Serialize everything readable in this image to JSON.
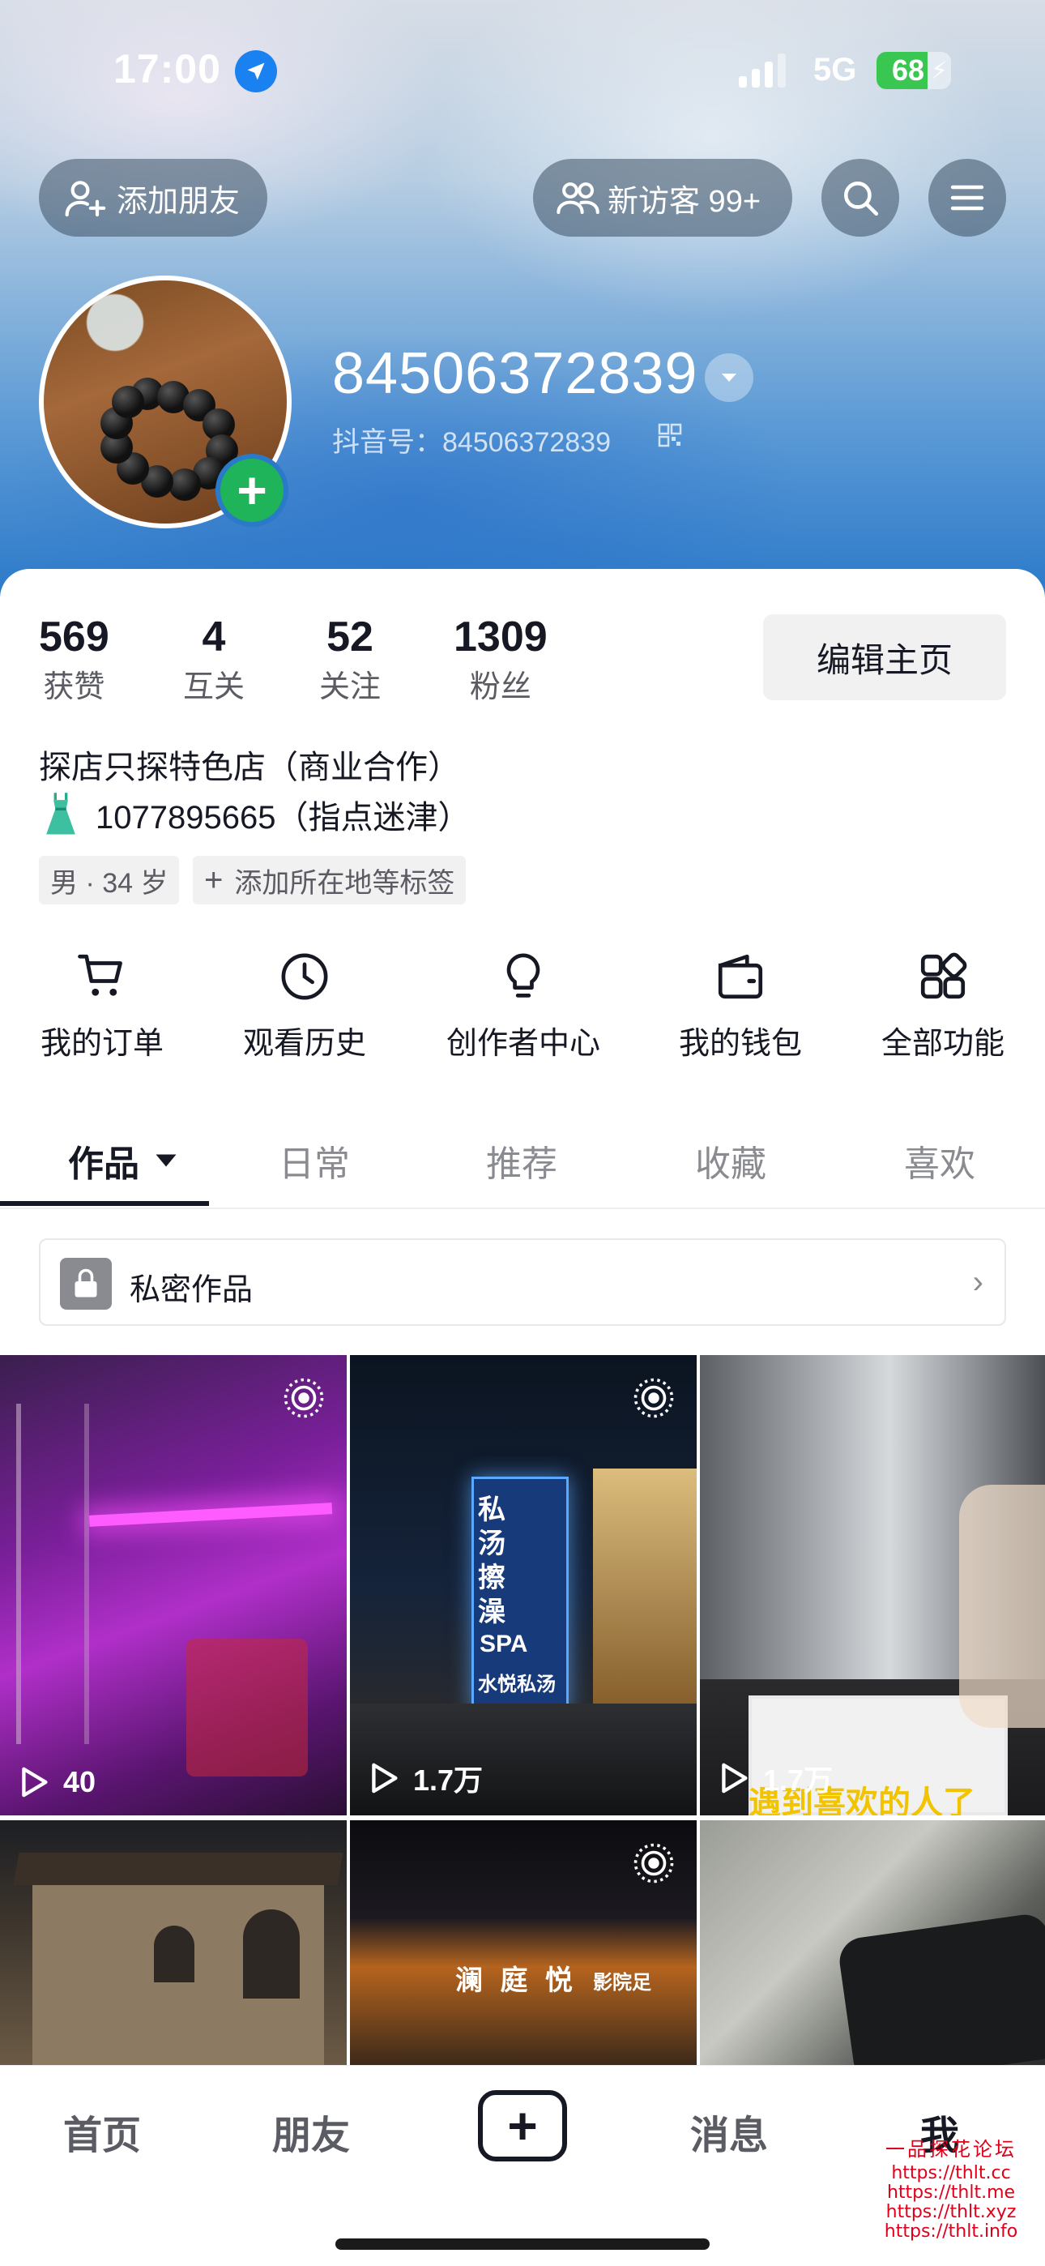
{
  "status_bar": {
    "time": "17:00",
    "network": "5G",
    "battery": "68",
    "battery_level": 0.68
  },
  "header": {
    "add_friend": "添加朋友",
    "new_visitors": "新访客 99+",
    "username": "84506372839",
    "douyin_id": "抖音号：84506372839"
  },
  "stats": [
    {
      "value": "569",
      "label": "获赞"
    },
    {
      "value": "4",
      "label": "互关"
    },
    {
      "value": "52",
      "label": "关注"
    },
    {
      "value": "1309",
      "label": "粉丝"
    }
  ],
  "edit_profile": "编辑主页",
  "bio": {
    "line1": "探店只探特色店（商业合作）",
    "line2_icon": "dress-icon",
    "line2": "1077895665（指点迷津）"
  },
  "tags": {
    "gender_age": "男 · 34 岁",
    "add_tag": "添加所在地等标签"
  },
  "functions": [
    {
      "label": "我的订单",
      "icon": "cart-icon"
    },
    {
      "label": "观看历史",
      "icon": "clock-icon"
    },
    {
      "label": "创作者中心",
      "icon": "bulb-icon"
    },
    {
      "label": "我的钱包",
      "icon": "wallet-icon"
    },
    {
      "label": "全部功能",
      "icon": "grid-icon"
    }
  ],
  "tabs": [
    {
      "label": "作品"
    },
    {
      "label": "日常"
    },
    {
      "label": "推荐"
    },
    {
      "label": "收藏"
    },
    {
      "label": "喜欢"
    }
  ],
  "private_works": "私密作品",
  "videos": [
    {
      "views": "40",
      "live": true
    },
    {
      "views": "1.7万",
      "live": true,
      "sign_text": "私汤擦澡",
      "sign_text2": "SPA",
      "sign_text3": "水悦私汤"
    },
    {
      "views": "1.7万",
      "live": false,
      "caption": "遇到喜欢的人了"
    },
    {
      "views": "",
      "live": false
    },
    {
      "views": "",
      "live": true,
      "sign_text": "澜 庭 悦",
      "sign_text2": "影院足"
    },
    {
      "views": "",
      "live": false
    }
  ],
  "bottom_nav": [
    {
      "label": "首页"
    },
    {
      "label": "朋友"
    },
    {
      "label": "消息"
    },
    {
      "label": "我"
    }
  ],
  "watermark": {
    "title": "一品探花论坛",
    "links": [
      "https://thlt.cc",
      "https://thlt.me",
      "https://thlt.xyz",
      "https://thlt.info"
    ]
  }
}
